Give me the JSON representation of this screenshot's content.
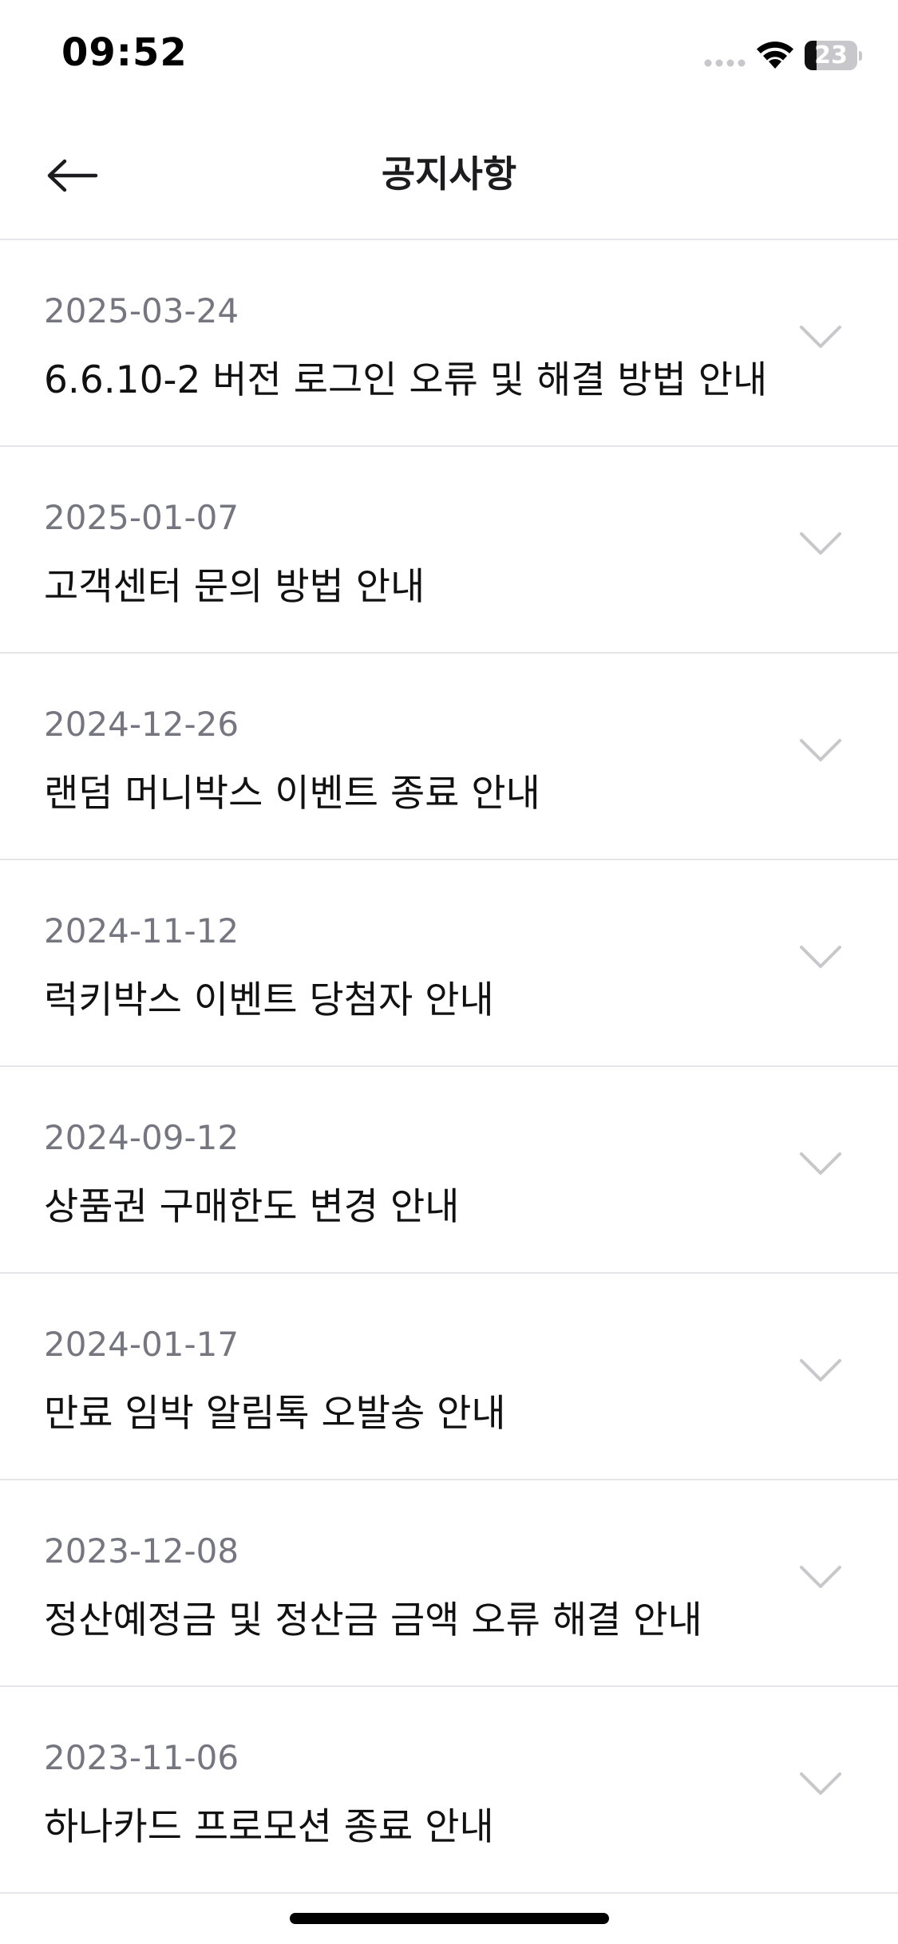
{
  "status_bar": {
    "time": "09:52",
    "battery_level": "23",
    "battery_fraction": 0.23
  },
  "header": {
    "title": "공지사항",
    "back_icon": "arrow-left-icon"
  },
  "notices": [
    {
      "date": "2025-03-24",
      "title": "6.6.10-2 버전 로그인 오류 및 해결 방법 안내"
    },
    {
      "date": "2025-01-07",
      "title": "고객센터 문의 방법 안내"
    },
    {
      "date": "2024-12-26",
      "title": "랜덤 머니박스 이벤트 종료 안내"
    },
    {
      "date": "2024-11-12",
      "title": "럭키박스 이벤트 당첨자 안내"
    },
    {
      "date": "2024-09-12",
      "title": "상품권 구매한도 변경 안내"
    },
    {
      "date": "2024-01-17",
      "title": "만료 임박 알림톡 오발송 안내"
    },
    {
      "date": "2023-12-08",
      "title": "정산예정금 및 정산금 금액 오류 해결 안내"
    },
    {
      "date": "2023-11-06",
      "title": "하나카드 프로모션 종료 안내"
    }
  ],
  "icons": {
    "expand": "chevron-down-icon"
  },
  "colors": {
    "date_text": "#767680",
    "title_text": "#111111",
    "divider": "#e5e5ea",
    "chevron": "#c7c7cc"
  }
}
